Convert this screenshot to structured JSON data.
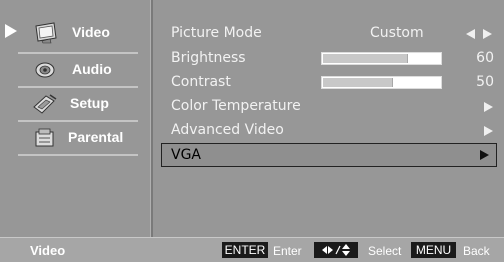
{
  "sidebar": {
    "items": [
      {
        "label": "Video",
        "icon": "tv-icon",
        "selected": true
      },
      {
        "label": "Audio",
        "icon": "speaker-icon",
        "selected": false
      },
      {
        "label": "Setup",
        "icon": "setup-icon",
        "selected": false
      },
      {
        "label": "Parental",
        "icon": "parental-icon",
        "selected": false
      }
    ]
  },
  "main": {
    "items": [
      {
        "label": "Picture Mode",
        "value": "Custom",
        "control": "left-right-arrows"
      },
      {
        "label": "Brightness",
        "value": "60",
        "level": 60,
        "control": "slider"
      },
      {
        "label": "Contrast",
        "value": "50",
        "level": 50,
        "control": "slider"
      },
      {
        "label": "Color Temperature",
        "control": "submenu-arrow"
      },
      {
        "label": "Advanced Video",
        "control": "submenu-arrow"
      },
      {
        "label": "VGA",
        "control": "submenu-arrow",
        "highlighted": true
      }
    ]
  },
  "footer": {
    "title": "Video",
    "hints": [
      {
        "key": "ENTER",
        "label": "Enter"
      },
      {
        "key_icon": "arrows-key-icon",
        "label": "Select"
      },
      {
        "key": "MENU",
        "label": "Back"
      }
    ]
  },
  "colors": {
    "background": "#979797",
    "text": "#f2f2f2",
    "highlight_border": "#222222",
    "key_bg": "#1a1a1a"
  }
}
